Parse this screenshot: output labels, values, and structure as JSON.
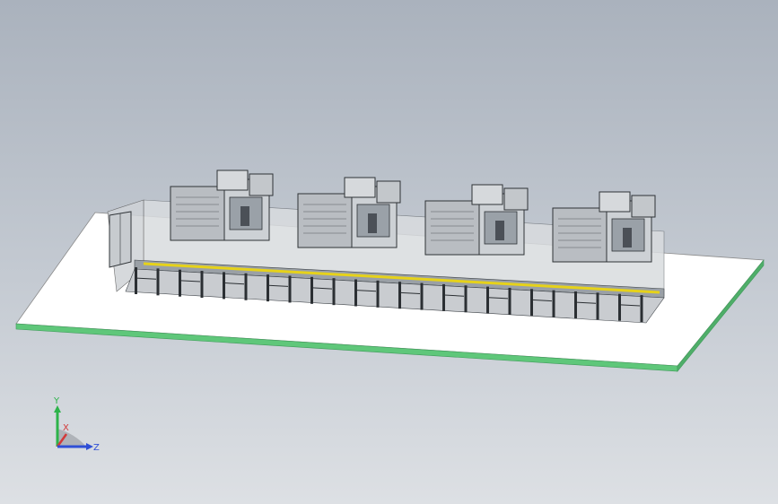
{
  "viewport": {
    "background_top": "#aab2bd",
    "background_bottom": "#dde0e4",
    "floor_color": "#ffffff",
    "floor_edge_color": "#5fc77a",
    "guard_rail_color": "#e6d21a",
    "cell_count": 4
  },
  "triad": {
    "y_label": "Y",
    "x_label": "X",
    "z_label": "Z",
    "y_color": "#2db34a",
    "x_color": "#d23a3a",
    "z_color": "#2f4fd6"
  }
}
